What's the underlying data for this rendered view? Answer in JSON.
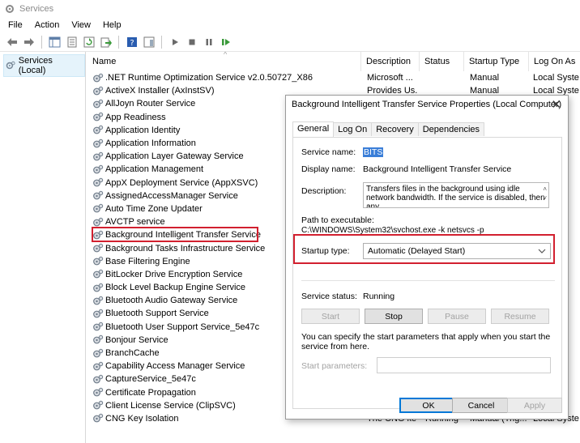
{
  "window": {
    "title": "Services"
  },
  "menu": [
    "File",
    "Action",
    "View",
    "Help"
  ],
  "tree": {
    "item": "Services (Local)"
  },
  "columns": {
    "name": "Name",
    "description": "Description",
    "status": "Status",
    "startup_type": "Startup Type",
    "log_on_as": "Log On As"
  },
  "services": [
    {
      "name": ".NET Runtime Optimization Service v2.0.50727_X86",
      "description": "Microsoft ...",
      "status": "",
      "startup": "Manual",
      "logon": "Local Syste"
    },
    {
      "name": "ActiveX Installer (AxInstSV)",
      "description": "Provides Us...",
      "status": "",
      "startup": "Manual",
      "logon": "Local Syste"
    },
    {
      "name": "AllJoyn Router Service",
      "description": "",
      "status": "",
      "startup": "",
      "logon": "vice"
    },
    {
      "name": "App Readiness",
      "description": "",
      "status": "",
      "startup": "",
      "logon": "te"
    },
    {
      "name": "Application Identity",
      "description": "",
      "status": "",
      "startup": "",
      "logon": "te"
    },
    {
      "name": "Application Information",
      "description": "",
      "status": "",
      "startup": "",
      "logon": "te"
    },
    {
      "name": "Application Layer Gateway Service",
      "description": "",
      "status": "",
      "startup": "",
      "logon": "te"
    },
    {
      "name": "Application Management",
      "description": "",
      "status": "",
      "startup": "",
      "logon": "te"
    },
    {
      "name": "AppX Deployment Service (AppXSVC)",
      "description": "",
      "status": "",
      "startup": "",
      "logon": "te"
    },
    {
      "name": "AssignedAccessManager Service",
      "description": "",
      "status": "",
      "startup": "",
      "logon": "te"
    },
    {
      "name": "Auto Time Zone Updater",
      "description": "",
      "status": "",
      "startup": "",
      "logon": "te"
    },
    {
      "name": "AVCTP service",
      "description": "",
      "status": "",
      "startup": "",
      "logon": "vice"
    },
    {
      "name": "Background Intelligent Transfer Service",
      "description": "",
      "status": "",
      "startup": "",
      "logon": "te"
    },
    {
      "name": "Background Tasks Infrastructure Service",
      "description": "",
      "status": "",
      "startup": "",
      "logon": "te"
    },
    {
      "name": "Base Filtering Engine",
      "description": "",
      "status": "",
      "startup": "",
      "logon": "vice"
    },
    {
      "name": "BitLocker Drive Encryption Service",
      "description": "",
      "status": "",
      "startup": "",
      "logon": "te"
    },
    {
      "name": "Block Level Backup Engine Service",
      "description": "",
      "status": "",
      "startup": "",
      "logon": "te"
    },
    {
      "name": "Bluetooth Audio Gateway Service",
      "description": "",
      "status": "",
      "startup": "",
      "logon": "vice"
    },
    {
      "name": "Bluetooth Support Service",
      "description": "",
      "status": "",
      "startup": "",
      "logon": "vice"
    },
    {
      "name": "Bluetooth User Support Service_5e47c",
      "description": "",
      "status": "",
      "startup": "",
      "logon": "te"
    },
    {
      "name": "Bonjour Service",
      "description": "",
      "status": "",
      "startup": "",
      "logon": "te"
    },
    {
      "name": "BranchCache",
      "description": "",
      "status": "",
      "startup": "",
      "logon": "vice"
    },
    {
      "name": "Capability Access Manager Service",
      "description": "",
      "status": "",
      "startup": "",
      "logon": "te"
    },
    {
      "name": "CaptureService_5e47c",
      "description": "",
      "status": "",
      "startup": "",
      "logon": "te"
    },
    {
      "name": "Certificate Propagation",
      "description": "",
      "status": "",
      "startup": "",
      "logon": "te"
    },
    {
      "name": "Client License Service (ClipSVC)",
      "description": "",
      "status": "",
      "startup": "",
      "logon": "te"
    },
    {
      "name": "CNG Key Isolation",
      "description": "The CNG ke...",
      "status": "Running",
      "startup": "Manual (Trig...",
      "logon": "Local Syste"
    }
  ],
  "dialog": {
    "title": "Background Intelligent Transfer Service Properties (Local Computer)",
    "tabs": [
      "General",
      "Log On",
      "Recovery",
      "Dependencies"
    ],
    "service_name_label": "Service name:",
    "service_name": "BITS",
    "display_name_label": "Display name:",
    "display_name": "Background Intelligent Transfer Service",
    "description_label": "Description:",
    "description": "Transfers files in the background using idle network bandwidth. If the service is disabled, then any",
    "path_label": "Path to executable:",
    "path": "C:\\WINDOWS\\System32\\svchost.exe -k netsvcs -p",
    "startup_type_label": "Startup type:",
    "startup_type": "Automatic (Delayed Start)",
    "status_label": "Service status:",
    "status": "Running",
    "buttons": {
      "start": "Start",
      "stop": "Stop",
      "pause": "Pause",
      "resume": "Resume"
    },
    "note": "You can specify the start parameters that apply when you start the service from here.",
    "start_params_label": "Start parameters:",
    "start_params": "",
    "footer": {
      "ok": "OK",
      "cancel": "Cancel",
      "apply": "Apply"
    }
  },
  "colors": {
    "highlight_red": "#d2202f",
    "selection_blue": "#3a7ed8",
    "tree_selected": "#e5f3fb"
  }
}
